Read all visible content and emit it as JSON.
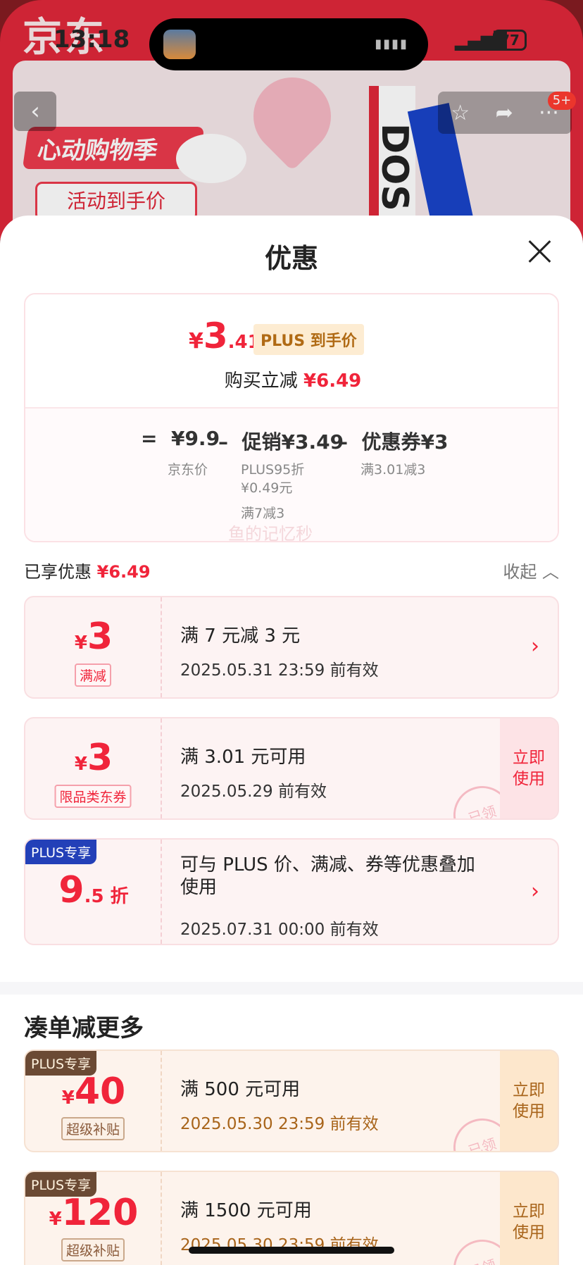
{
  "status": {
    "time": "13:18",
    "battery": "77"
  },
  "background": {
    "logo": "京东",
    "banner_text": "心动购物季",
    "banner_btn": "活动到手价",
    "box_text": "DOS",
    "badge": "5+"
  },
  "sheet": {
    "title": "优惠",
    "summary": {
      "currency": "¥",
      "price_int": "3",
      "price_dec": ".41",
      "plus_tag": "PLUS 到手价",
      "save_label": "购买立减",
      "save_amount": "¥6.49",
      "calc": [
        {
          "op": "=",
          "value": "¥9.9",
          "sub": [
            "京东价"
          ]
        },
        {
          "op": "–",
          "value": "促销¥3.49",
          "sub": [
            "PLUS95折",
            "¥0.49元",
            "",
            "满7减3"
          ]
        },
        {
          "op": "–",
          "value": "优惠券¥3",
          "sub": [
            "满3.01减3"
          ]
        }
      ]
    },
    "enjoyed_label": "已享优惠",
    "enjoyed_amount": "¥6.49",
    "collapse_label": "收起",
    "watermark": "鱼的记忆秒",
    "coupons": [
      {
        "cur": "¥",
        "amount": "3",
        "tag": "满减",
        "main": "满 7 元减 3 元",
        "sub": "2025.05.31 23:59 前有效",
        "action": "›"
      },
      {
        "cur": "¥",
        "amount": "3",
        "tag": "限品类东券",
        "main": "满 3.01 元可用",
        "sub": "2025.05.29 前有效",
        "action": "立即使用",
        "stamp": "已领"
      },
      {
        "corner": "PLUS专享",
        "discount_big": "9",
        "discount_small": ".5 折",
        "main_line1": "可与 PLUS 价、满减、券等优惠叠加",
        "main_line2": "使用",
        "sub": "2025.07.31 00:00 前有效",
        "action": "›"
      }
    ],
    "more_title": "凑单减更多",
    "more_coupons": [
      {
        "corner": "PLUS专享",
        "cur": "¥",
        "amount": "40",
        "tag": "超级补贴",
        "main": "满 500 元可用",
        "sub": "2025.05.30 23:59 前有效",
        "action": "立即使用",
        "stamp": "已领"
      },
      {
        "corner": "PLUS专享",
        "cur": "¥",
        "amount": "120",
        "tag": "超级补贴",
        "main": "满 1500 元可用",
        "sub": "2025.05.30 23:59 前有效",
        "action": "立即使用",
        "stamp": "已领"
      }
    ]
  }
}
